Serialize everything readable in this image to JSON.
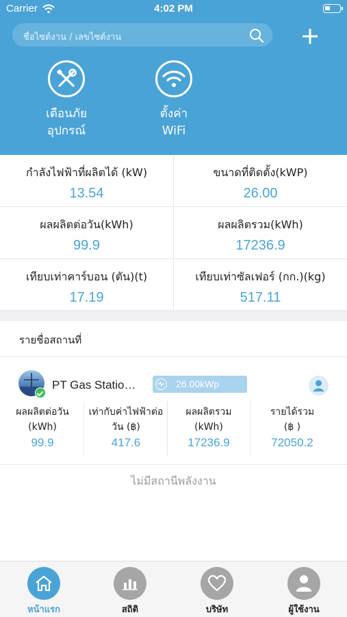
{
  "status_bar": {
    "carrier": "Carrier",
    "time": "4:02 PM"
  },
  "header": {
    "search_placeholder": "ชื่อไซต์งาน / เลขไซต์งาน",
    "quick_actions": [
      {
        "line1": "เตือนภัย",
        "line2": "อุปกรณ์",
        "icon": "tools-icon"
      },
      {
        "line1": "ตั้งค่า",
        "line2": "WiFi",
        "icon": "wifi-icon"
      }
    ]
  },
  "stats": [
    {
      "label": "กำลังไฟฟ้าที่ผลิตได้ (kW)",
      "value": "13.54"
    },
    {
      "label": "ขนาดที่ติดตั้ง(kWP)",
      "value": "26.00"
    },
    {
      "label": "ผลผลิตต่อวัน(kWh)",
      "value": "99.9"
    },
    {
      "label": "ผลผลิตรวม(kWh)",
      "value": "17236.9"
    },
    {
      "label": "เทียบเท่าคาร์บอน (ตัน)(t)",
      "value": "17.19"
    },
    {
      "label": "เทียบเท่าซัลเฟอร์ (กก.)(kg)",
      "value": "517.11"
    }
  ],
  "site_list": {
    "title": "รายชื่อสถานที่",
    "station": {
      "name": "PT Gas Statio…",
      "capacity": "26.00kWp",
      "metrics": [
        {
          "line1": "ผลผลิตต่อวัน",
          "line2": "(kWh)",
          "value": "99.9"
        },
        {
          "line1": "เท่ากับค่าไฟฟ้าต่อ",
          "line2": "วัน (฿)",
          "value": "417.6"
        },
        {
          "line1": "ผลผลิตรวม",
          "line2": "(kWh)",
          "value": "17236.9"
        },
        {
          "line1": "รายได้รวม",
          "line2": "(฿ )",
          "value": "72050.2"
        }
      ]
    },
    "empty_text": "ไม่มีสถานีพลังงาน"
  },
  "tabbar": [
    {
      "label": "หน้าแรก",
      "icon": "home-icon",
      "active": true
    },
    {
      "label": "สถิติ",
      "icon": "bar-chart-icon",
      "active": false
    },
    {
      "label": "บริษัท",
      "icon": "heart-icon",
      "active": false
    },
    {
      "label": "ผู้ใช้งาน",
      "icon": "user-icon",
      "active": false
    }
  ],
  "colors": {
    "accent": "#4aa3d6",
    "inactive_tab": "#a6a6a6",
    "success": "#3dbd5a"
  }
}
